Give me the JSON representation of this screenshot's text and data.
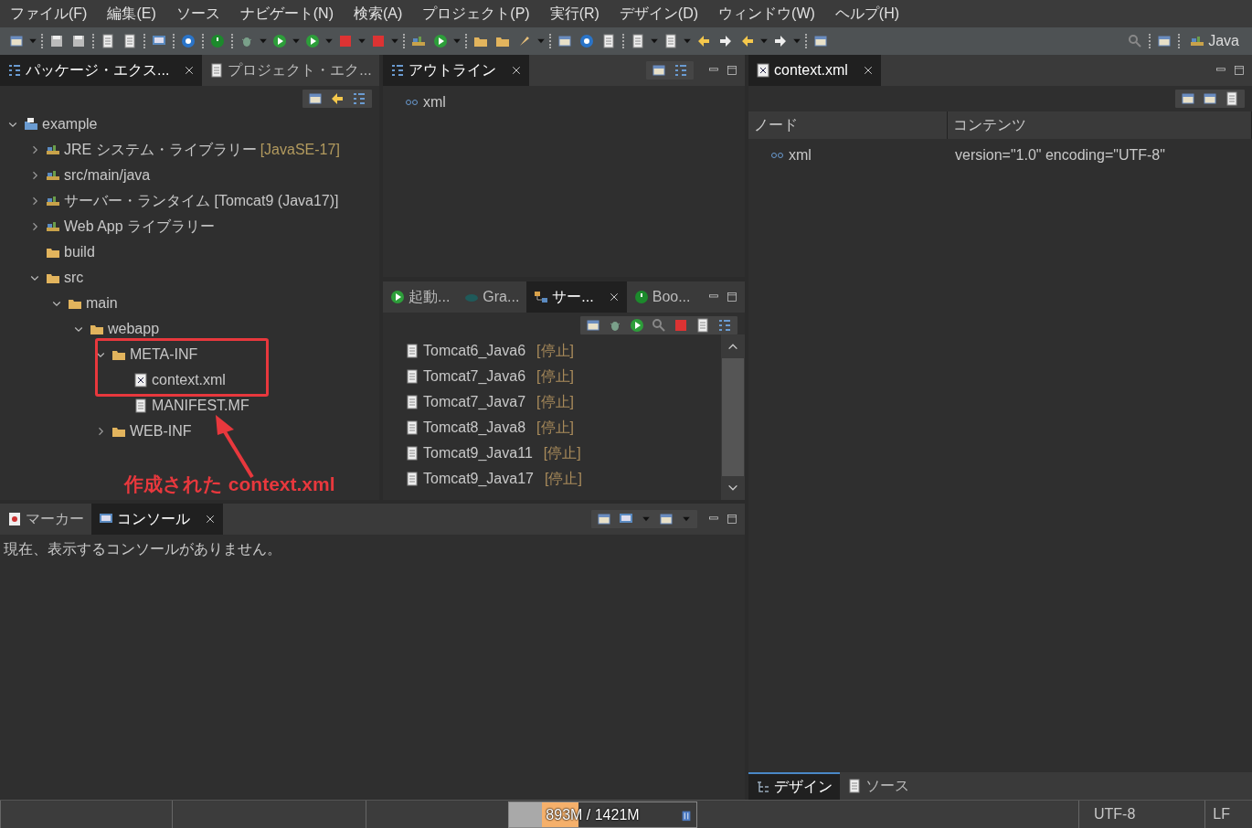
{
  "menu": [
    "ファイル(F)",
    "編集(E)",
    "ソース",
    "ナビゲート(N)",
    "検索(A)",
    "プロジェクト(P)",
    "実行(R)",
    "デザイン(D)",
    "ウィンドウ(W)",
    "ヘルプ(H)"
  ],
  "perspective": {
    "label": "Java"
  },
  "package_panel": {
    "tabs": [
      {
        "label": "パッケージ・エクス...",
        "kind": "package",
        "selected": true
      },
      {
        "label": "プロジェクト・エク...",
        "kind": "project",
        "selected": false
      }
    ],
    "tree": [
      {
        "label": "example",
        "kind": "project",
        "expanded": true,
        "children": [
          {
            "label": "JRE システム・ライブラリー",
            "decoration": "[JavaSE-17]",
            "kind": "library",
            "expanded": false
          },
          {
            "label": "src/main/java",
            "kind": "srcfolder",
            "expanded": false
          },
          {
            "label": "サーバー・ランタイム [Tomcat9 (Java17)]",
            "kind": "library",
            "expanded": false
          },
          {
            "label": "Web App ライブラリー",
            "kind": "library",
            "expanded": false
          },
          {
            "label": "build",
            "kind": "folder"
          },
          {
            "label": "src",
            "kind": "folder",
            "expanded": true,
            "children": [
              {
                "label": "main",
                "kind": "folder",
                "expanded": true,
                "children": [
                  {
                    "label": "webapp",
                    "kind": "folder",
                    "expanded": true,
                    "children": [
                      {
                        "label": "META-INF",
                        "kind": "folder",
                        "expanded": true,
                        "children": [
                          {
                            "label": "context.xml",
                            "kind": "xmlfile"
                          },
                          {
                            "label": "MANIFEST.MF",
                            "kind": "textfile"
                          }
                        ]
                      },
                      {
                        "label": "WEB-INF",
                        "kind": "folder",
                        "expanded": false
                      }
                    ]
                  }
                ]
              }
            ]
          }
        ]
      }
    ],
    "annotation": {
      "text": "作成された context.xml",
      "color": "#e8383d"
    }
  },
  "outline_panel": {
    "tabs": [
      {
        "label": "アウトライン",
        "kind": "outline",
        "selected": true
      }
    ],
    "items": [
      {
        "label": "xml"
      }
    ]
  },
  "servers_panel": {
    "tabs": [
      {
        "label": "起動...",
        "kind": "launch",
        "selected": false
      },
      {
        "label": "Gra...",
        "kind": "gradle",
        "selected": false
      },
      {
        "label": "サー...",
        "kind": "servers",
        "selected": true
      },
      {
        "label": "Boo...",
        "kind": "boot",
        "selected": false
      }
    ],
    "servers": [
      {
        "name": "Tomcat6_Java6",
        "status": "[停止]"
      },
      {
        "name": "Tomcat7_Java6",
        "status": "[停止]"
      },
      {
        "name": "Tomcat7_Java7",
        "status": "[停止]"
      },
      {
        "name": "Tomcat8_Java8",
        "status": "[停止]"
      },
      {
        "name": "Tomcat9_Java11",
        "status": "[停止]"
      },
      {
        "name": "Tomcat9_Java17",
        "status": "[停止]"
      }
    ]
  },
  "console_panel": {
    "tabs": [
      {
        "label": "マーカー",
        "kind": "markers",
        "selected": false
      },
      {
        "label": "コンソール",
        "kind": "console",
        "selected": true
      }
    ],
    "message": "現在、表示するコンソールがありません。"
  },
  "editor": {
    "tabs": [
      {
        "label": "context.xml",
        "kind": "xmlfile",
        "selected": true
      }
    ],
    "table": {
      "columns": [
        "ノード",
        "コンテンツ"
      ],
      "rows": [
        {
          "node": "xml",
          "content": "version=\"1.0\" encoding=\"UTF-8\""
        }
      ]
    },
    "bottom_tabs": [
      {
        "label": "デザイン",
        "kind": "design",
        "selected": true
      },
      {
        "label": "ソース",
        "kind": "source",
        "selected": false
      }
    ]
  },
  "status_bar": {
    "heap": {
      "text": "893M / 1421M",
      "level": 0.37
    },
    "encoding": "UTF-8",
    "line_delimiter": "LF"
  }
}
